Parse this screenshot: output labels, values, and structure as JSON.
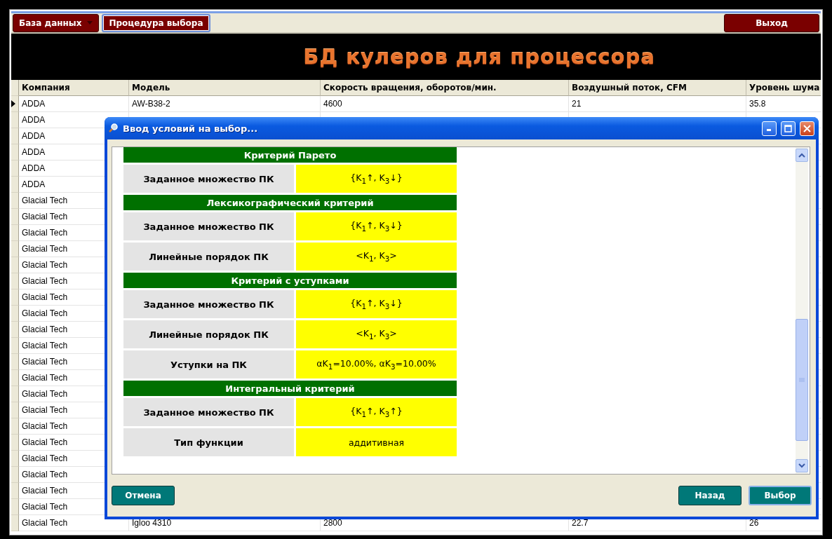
{
  "toolbar": {
    "buttons": [
      {
        "label": "База данных",
        "has_menu": true,
        "focused": false
      },
      {
        "label": "Процедура выбора",
        "has_menu": false,
        "focused": true
      }
    ],
    "exit_button": "Выход"
  },
  "banner": {
    "title": "БД кулеров для процессора"
  },
  "table": {
    "columns": [
      "Компания",
      "Модель",
      "Скорость вращения, оборотов/мин.",
      "Воздушный поток, CFM",
      "Уровень шума"
    ],
    "rows": [
      {
        "current": true,
        "cells": [
          "ADDA",
          "AW-B38-2",
          "4600",
          "21",
          "35.8"
        ]
      },
      {
        "current": false,
        "cells": [
          "ADDA"
        ]
      },
      {
        "current": false,
        "cells": [
          "ADDA"
        ]
      },
      {
        "current": false,
        "cells": [
          "ADDA"
        ]
      },
      {
        "current": false,
        "cells": [
          "ADDA"
        ]
      },
      {
        "current": false,
        "cells": [
          "ADDA"
        ]
      },
      {
        "current": false,
        "cells": [
          "Glacial Tech"
        ]
      },
      {
        "current": false,
        "cells": [
          "Glacial Tech"
        ]
      },
      {
        "current": false,
        "cells": [
          "Glacial Tech"
        ]
      },
      {
        "current": false,
        "cells": [
          "Glacial Tech"
        ]
      },
      {
        "current": false,
        "cells": [
          "Glacial Tech"
        ]
      },
      {
        "current": false,
        "cells": [
          "Glacial Tech"
        ]
      },
      {
        "current": false,
        "cells": [
          "Glacial Tech"
        ]
      },
      {
        "current": false,
        "cells": [
          "Glacial Tech"
        ]
      },
      {
        "current": false,
        "cells": [
          "Glacial Tech"
        ]
      },
      {
        "current": false,
        "cells": [
          "Glacial Tech"
        ]
      },
      {
        "current": false,
        "cells": [
          "Glacial Tech"
        ]
      },
      {
        "current": false,
        "cells": [
          "Glacial Tech"
        ]
      },
      {
        "current": false,
        "cells": [
          "Glacial Tech"
        ]
      },
      {
        "current": false,
        "cells": [
          "Glacial Tech"
        ]
      },
      {
        "current": false,
        "cells": [
          "Glacial Tech"
        ]
      },
      {
        "current": false,
        "cells": [
          "Glacial Tech"
        ]
      },
      {
        "current": false,
        "cells": [
          "Glacial Tech"
        ]
      },
      {
        "current": false,
        "cells": [
          "Glacial Tech"
        ]
      },
      {
        "current": false,
        "cells": [
          "Glacial Tech"
        ]
      },
      {
        "current": false,
        "cells": [
          "Glacial Tech"
        ]
      },
      {
        "current": false,
        "cells": [
          "Glacial Tech",
          "Igloo 4310",
          "2800",
          "22.7",
          "26"
        ]
      }
    ]
  },
  "dialog": {
    "title": "Ввод условий на выбор...",
    "sections": [
      {
        "title": "Критерий Парето",
        "rows": [
          {
            "label": "Заданное множество ПК",
            "value": "{K$_{1}$↑, K$_{3}$↓}"
          }
        ]
      },
      {
        "title": "Лексикографический критерий",
        "rows": [
          {
            "label": "Заданное множество ПК",
            "value": "{K$_{1}$↑, K$_{3}$↓}"
          },
          {
            "label": "Линейные порядок ПК",
            "value": "<K$_{1}$, K$_{3}$>"
          }
        ]
      },
      {
        "title": "Критерий с уступками",
        "rows": [
          {
            "label": "Заданное множество ПК",
            "value": "{K$_{1}$↑, K$_{3}$↓}"
          },
          {
            "label": "Линейные порядок ПК",
            "value": "<K$_{1}$, K$_{3}$>"
          },
          {
            "label": "Уступки на ПК",
            "value": "αK$_{1}$=10.00%, αK$_{3}$=10.00%"
          }
        ]
      },
      {
        "title": "Интегральный критерий",
        "rows": [
          {
            "label": "Заданное множество ПК",
            "value": "{K$_{1}$↑, K$_{3}$↑}"
          },
          {
            "label": "Тип функции",
            "value": "аддитивная"
          }
        ]
      }
    ],
    "left_buttons": [
      {
        "label": "Отмена",
        "focused": false
      }
    ],
    "right_buttons": [
      {
        "label": "Назад",
        "focused": false
      },
      {
        "label": "Выбор",
        "focused": true
      }
    ]
  }
}
